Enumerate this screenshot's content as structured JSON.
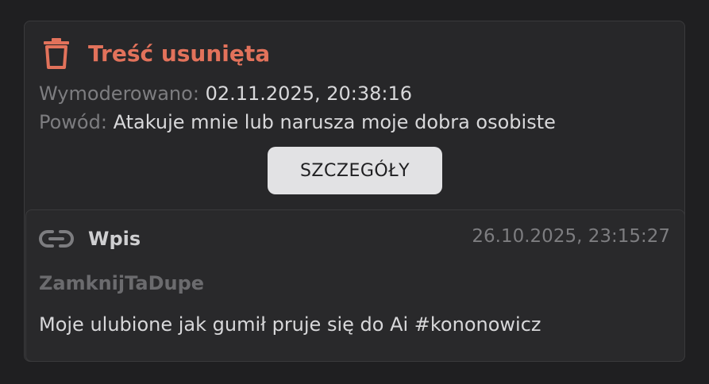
{
  "moderation": {
    "title": "Treść usunięta",
    "title_color": "#e2725b",
    "icon": "trash-icon",
    "moderated_label": "Wymoderowano:",
    "moderated_value": "02.11.2025, 20:38:16",
    "reason_label": "Powód:",
    "reason_value": "Atakuje mnie lub narusza moje dobra osobiste",
    "details_button": "SZCZEGÓŁY"
  },
  "post": {
    "icon": "link-icon",
    "type_label": "Wpis",
    "date": "26.10.2025, 23:15:27",
    "author": "ZamknijTaDupe",
    "text": "Moje ulubione jak gumił pruje się do Ai #kononowicz"
  }
}
